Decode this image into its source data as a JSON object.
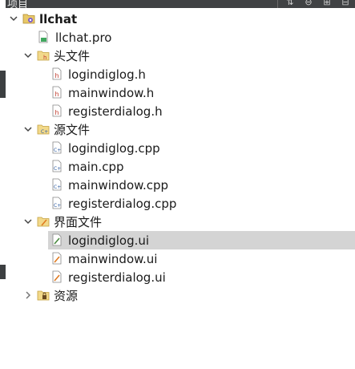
{
  "panel": {
    "title": "项目"
  },
  "tree": {
    "root": {
      "label": "llchat"
    },
    "pro_file": {
      "label": "llchat.pro"
    },
    "headers": {
      "label": "头文件",
      "items": [
        "logindiglog.h",
        "mainwindow.h",
        "registerdialog.h"
      ]
    },
    "sources": {
      "label": "源文件",
      "items": [
        "logindiglog.cpp",
        "main.cpp",
        "mainwindow.cpp",
        "registerdialog.cpp"
      ]
    },
    "forms": {
      "label": "界面文件",
      "items": [
        "logindiglog.ui",
        "mainwindow.ui",
        "registerdialog.ui"
      ]
    },
    "resources": {
      "label": "资源"
    }
  }
}
